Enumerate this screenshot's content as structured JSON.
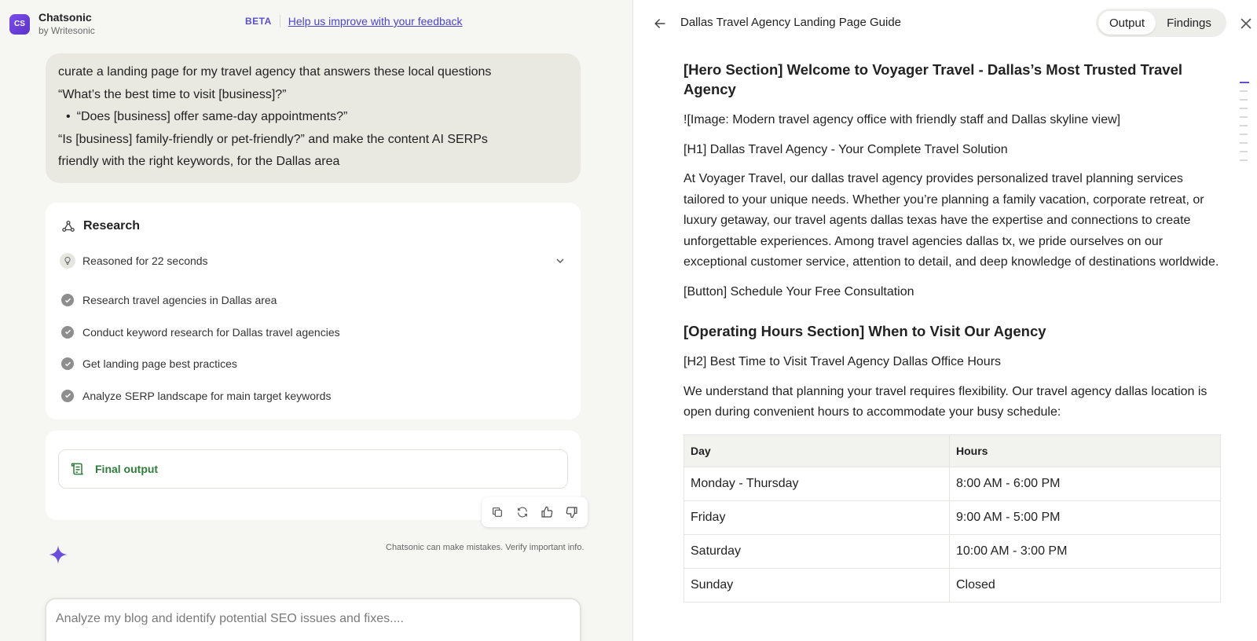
{
  "brand": {
    "logo_text": "CS",
    "name": "Chatsonic",
    "sub": "by Writesonic"
  },
  "header": {
    "beta": "BETA",
    "feedback_link": "Help us improve with your feedback"
  },
  "user_message": {
    "line1": "curate a landing page for my travel agency that answers these local questions",
    "line2": "“What’s the best time to visit [business]?”",
    "bullet": "“Does [business] offer same-day appointments?”",
    "line3": "“Is [business] family-friendly or pet-friendly?” and make the content AI SERPs",
    "line4": "friendly with the right keywords, for the Dallas area"
  },
  "research": {
    "title": "Research",
    "reasoned": "Reasoned for 22 seconds",
    "steps": [
      "Research travel agencies in Dallas area",
      "Conduct keyword research for Dallas travel agencies",
      "Get landing page best practices",
      "Analyze SERP landscape for main target keywords"
    ]
  },
  "final_output": {
    "label": "Final output"
  },
  "disclaimer": "Chatsonic can make mistakes. Verify important info.",
  "composer": {
    "placeholder": "Analyze my blog and identify potential SEO issues and fixes...."
  },
  "doc": {
    "title": "Dallas Travel Agency Landing Page Guide",
    "tabs": {
      "output": "Output",
      "findings": "Findings"
    },
    "hero_heading": "[Hero Section] Welcome to Voyager Travel - Dallas’s Most Trusted Travel Agency",
    "image_line": "![Image: Modern travel agency office with friendly staff and Dallas skyline view]",
    "h1_line": "[H1] Dallas Travel Agency - Your Complete Travel Solution",
    "intro": "At Voyager Travel, our dallas travel agency provides personalized travel planning services tailored to your unique needs. Whether you’re planning a family vacation, corporate retreat, or luxury getaway, our travel agents dallas texas have the expertise and connections to create unforgettable experiences. Among travel agencies dallas tx, we pride ourselves on our exceptional customer service, attention to detail, and deep knowledge of destinations worldwide.",
    "button_line": "[Button] Schedule Your Free Consultation",
    "hours_heading": "[Operating Hours Section] When to Visit Our Agency",
    "h2_line": "[H2] Best Time to Visit Travel Agency Dallas Office Hours",
    "hours_intro": "We understand that planning your travel requires flexibility. Our travel agency dallas location is open during convenient hours to accommodate your busy schedule:",
    "table": {
      "headers": [
        "Day",
        "Hours"
      ],
      "rows": [
        [
          "Monday - Thursday",
          "8:00 AM - 6:00 PM"
        ],
        [
          "Friday",
          "9:00 AM - 5:00 PM"
        ],
        [
          "Saturday",
          "10:00 AM - 3:00 PM"
        ],
        [
          "Sunday",
          "Closed"
        ]
      ]
    }
  },
  "colors": {
    "accent": "#5b4fd6",
    "final_green": "#2f7d3a"
  }
}
